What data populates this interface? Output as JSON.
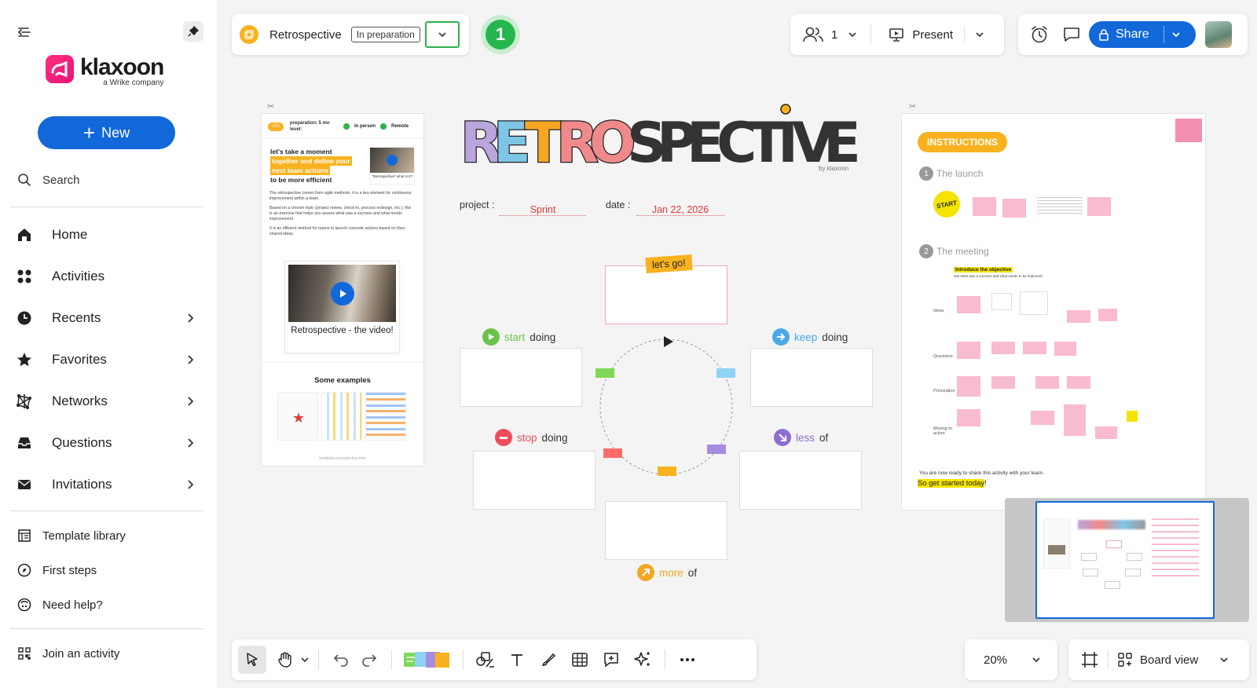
{
  "sidebar": {
    "brand": {
      "name": "klaxoon",
      "sub": "a Wrike company"
    },
    "new_label": "New",
    "search_label": "Search",
    "nav": [
      {
        "label": "Home",
        "icon": "home-icon",
        "chevron": false
      },
      {
        "label": "Activities",
        "icon": "activities-icon",
        "chevron": false
      },
      {
        "label": "Recents",
        "icon": "clock-icon",
        "chevron": true
      },
      {
        "label": "Favorites",
        "icon": "star-icon",
        "chevron": true
      },
      {
        "label": "Networks",
        "icon": "network-icon",
        "chevron": true
      },
      {
        "label": "Questions",
        "icon": "inbox-icon",
        "chevron": true
      },
      {
        "label": "Invitations",
        "icon": "mail-icon",
        "chevron": true
      }
    ],
    "secondary": [
      {
        "label": "Template library",
        "icon": "template-icon"
      },
      {
        "label": "First steps",
        "icon": "compass-icon"
      },
      {
        "label": "Need help?",
        "icon": "help-icon"
      }
    ],
    "join_label": "Join an activity"
  },
  "board_header": {
    "title": "Retrospective",
    "status": "In preparation",
    "step_number": "1"
  },
  "collab": {
    "participants": "1",
    "present_label": "Present"
  },
  "share_label": "Share",
  "board": {
    "left_card": {
      "tag": "info",
      "preparation_line": "preparation: 5 mn",
      "level_line": "level:",
      "mode_in_person": "In person",
      "mode_remote": "Remote",
      "headline_1": "let's take a moment",
      "headline_2": "together and define your",
      "headline_3": "next team actions",
      "headline_4": "to be more efficient",
      "video_caption_small": "\"Retrospective\" what is it?",
      "para1": "The retrospective comes from agile methods, it is a key element for continuous improvement within a team.",
      "para2": "Based on a chosen topic (project review, check-in, process redesign, etc.), this is an exercise that helps you assess what was a success and what needs improvement.",
      "para3": "It is an efficient method for teams to launch concrete actions based on their shared ideas.",
      "video_card_label": "Retrospective - the video!",
      "examples_title": "Some examples",
      "footer": "template-retrospective.klxn"
    },
    "title_letters": "RETROSPECTIVE",
    "title_by": "by klaxoon",
    "project_label": "project :",
    "project_value": "Sprint",
    "date_label": "date :",
    "date_value": "Jan 22, 2026",
    "lets_go": "let's go!",
    "zones": [
      {
        "key": "start",
        "word1": "start",
        "word2": "doing",
        "color": "#6cc24a"
      },
      {
        "key": "keep",
        "word1": "keep",
        "word2": "doing",
        "color": "#4aa8e8"
      },
      {
        "key": "stop",
        "word1": "stop",
        "word2": "doing",
        "color": "#ef4d5a"
      },
      {
        "key": "less",
        "word1": "less",
        "word2": "of",
        "color": "#8e6fd0"
      },
      {
        "key": "more",
        "word1": "more",
        "word2": "of",
        "color": "#f5a623"
      }
    ],
    "instructions": {
      "title": "INSTRUCTIONS",
      "step1_num": "1",
      "step1": "The launch",
      "start_badge": "START",
      "step2_num": "2",
      "step2": "The meeting",
      "objective": "Introduce the objective",
      "objective_sub": "see what was a success and what needs to be improved",
      "rows": [
        "Ideas",
        "Questions",
        "Priorization",
        "Moving to action"
      ],
      "ready": "You are now ready to share this activity with your team.",
      "cta": "So get started today",
      "cta_end": "!"
    }
  },
  "zoom": "20%",
  "view_label": "Board view",
  "colors": {
    "accent": "#1268d9",
    "status_outline": "#2eb24b",
    "brand_pink": "#e8147a"
  }
}
